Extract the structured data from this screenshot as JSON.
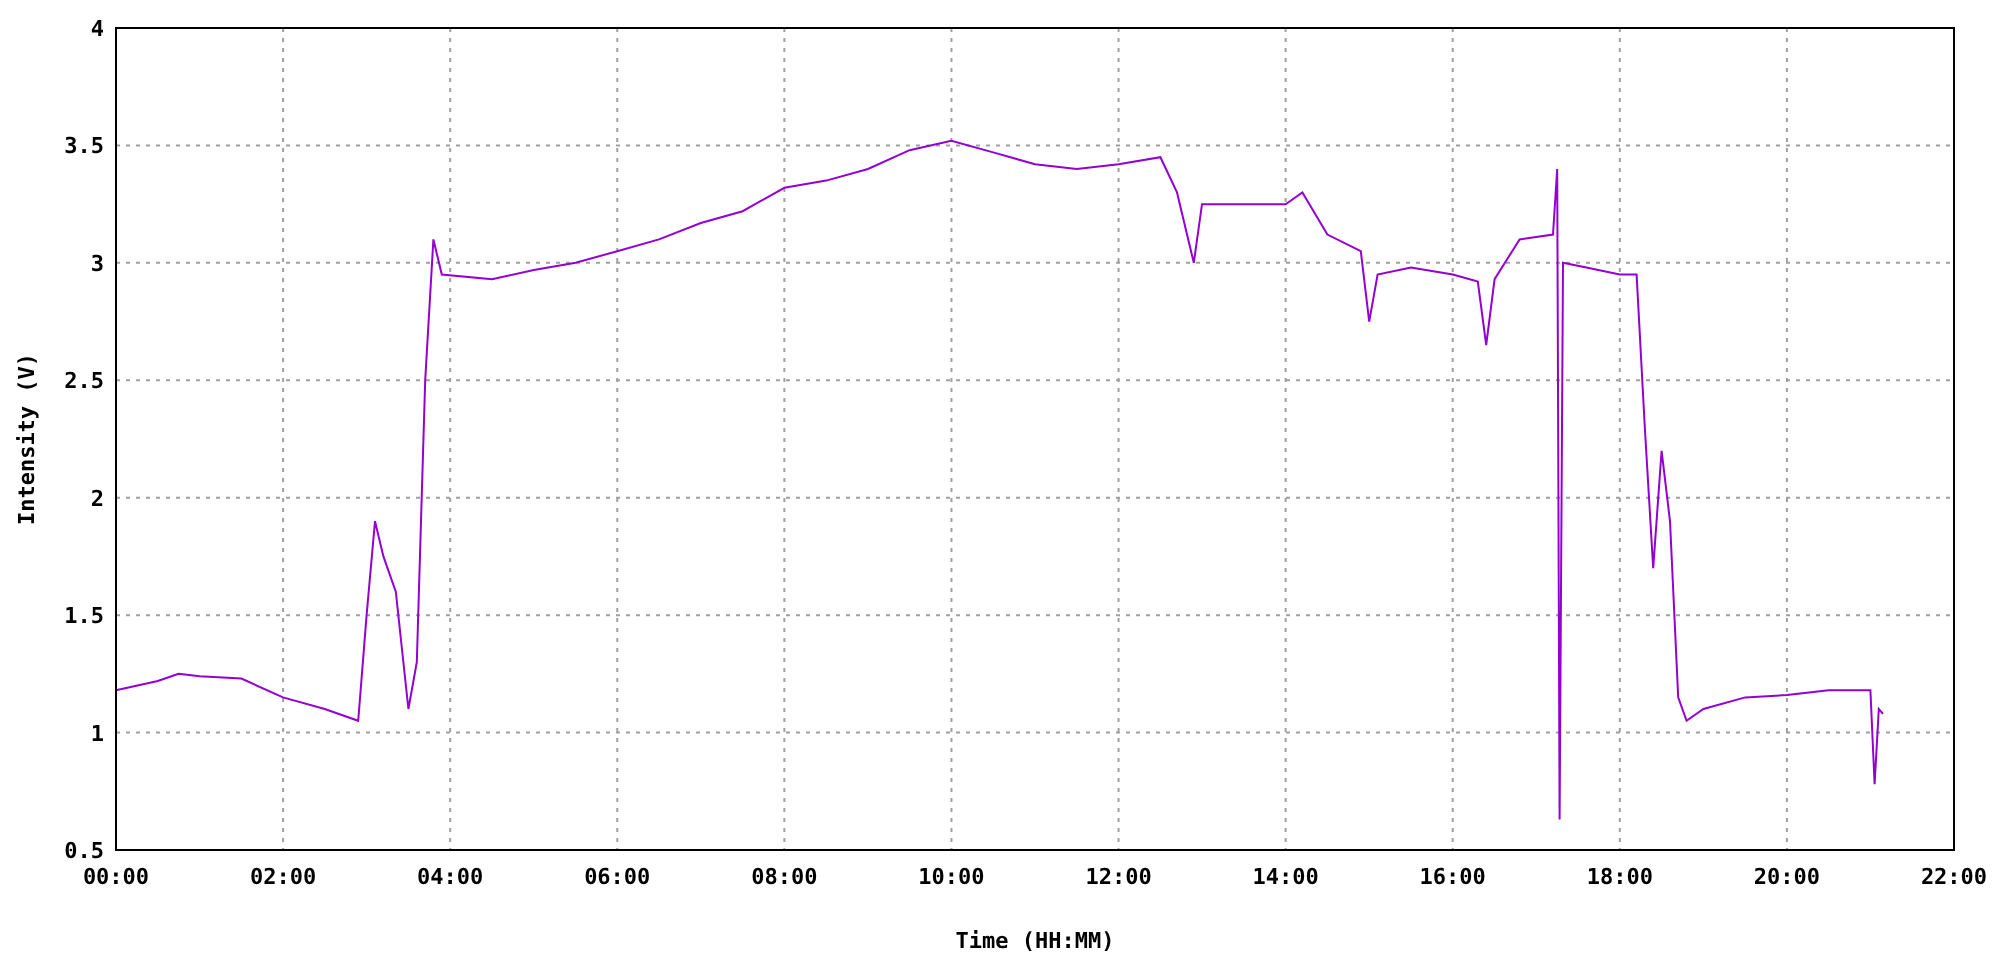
{
  "chart_data": {
    "type": "line",
    "grid": true,
    "xlabel": "Time (HH:MM)",
    "ylabel": "Intensity (V)",
    "xlim": [
      0,
      22
    ],
    "ylim": [
      0.5,
      4
    ],
    "xticks": [
      {
        "value": 0,
        "label": "00:00"
      },
      {
        "value": 2,
        "label": "02:00"
      },
      {
        "value": 4,
        "label": "04:00"
      },
      {
        "value": 6,
        "label": "06:00"
      },
      {
        "value": 8,
        "label": "08:00"
      },
      {
        "value": 10,
        "label": "10:00"
      },
      {
        "value": 12,
        "label": "12:00"
      },
      {
        "value": 14,
        "label": "14:00"
      },
      {
        "value": 16,
        "label": "16:00"
      },
      {
        "value": 18,
        "label": "18:00"
      },
      {
        "value": 20,
        "label": "20:00"
      },
      {
        "value": 22,
        "label": "22:00"
      }
    ],
    "yticks": [
      {
        "value": 0.5,
        "label": "0.5"
      },
      {
        "value": 1,
        "label": "1"
      },
      {
        "value": 1.5,
        "label": "1.5"
      },
      {
        "value": 2,
        "label": "2"
      },
      {
        "value": 2.5,
        "label": "2.5"
      },
      {
        "value": 3,
        "label": "3"
      },
      {
        "value": 3.5,
        "label": "3.5"
      },
      {
        "value": 4,
        "label": "4"
      }
    ],
    "x": [
      0,
      0.5,
      0.75,
      1,
      1.5,
      2,
      2.5,
      2.9,
      3,
      3.1,
      3.2,
      3.35,
      3.5,
      3.6,
      3.7,
      3.8,
      3.9,
      4.5,
      5,
      5.5,
      6,
      6.5,
      7,
      7.5,
      8,
      8.5,
      9,
      9.5,
      10,
      10.5,
      11,
      11.5,
      12,
      12.5,
      12.7,
      12.9,
      13,
      13.5,
      14,
      14.2,
      14.5,
      14.9,
      15,
      15.1,
      15.5,
      16,
      16.3,
      16.4,
      16.5,
      16.8,
      17.2,
      17.25,
      17.28,
      17.32,
      17.6,
      18,
      18.2,
      18.3,
      18.4,
      18.5,
      18.6,
      18.7,
      18.8,
      19,
      19.5,
      20,
      20.5,
      21,
      21.05,
      21.1,
      21.15
    ],
    "series": [
      {
        "color": "#9400d3",
        "values": [
          1.18,
          1.22,
          1.25,
          1.24,
          1.23,
          1.15,
          1.1,
          1.05,
          1.5,
          1.9,
          1.75,
          1.6,
          1.1,
          1.3,
          2.5,
          3.1,
          2.95,
          2.93,
          2.97,
          3,
          3.05,
          3.1,
          3.17,
          3.22,
          3.32,
          3.35,
          3.4,
          3.48,
          3.52,
          3.47,
          3.42,
          3.4,
          3.42,
          3.45,
          3.3,
          3,
          3.25,
          3.25,
          3.25,
          3.3,
          3.12,
          3.05,
          2.75,
          2.95,
          2.98,
          2.95,
          2.92,
          2.65,
          2.93,
          3.1,
          3.12,
          3.4,
          0.63,
          3,
          2.98,
          2.95,
          2.95,
          2.3,
          1.7,
          2.2,
          1.9,
          1.15,
          1.05,
          1.1,
          1.15,
          1.16,
          1.18,
          1.18,
          0.78,
          1.1,
          1.08
        ]
      }
    ]
  }
}
